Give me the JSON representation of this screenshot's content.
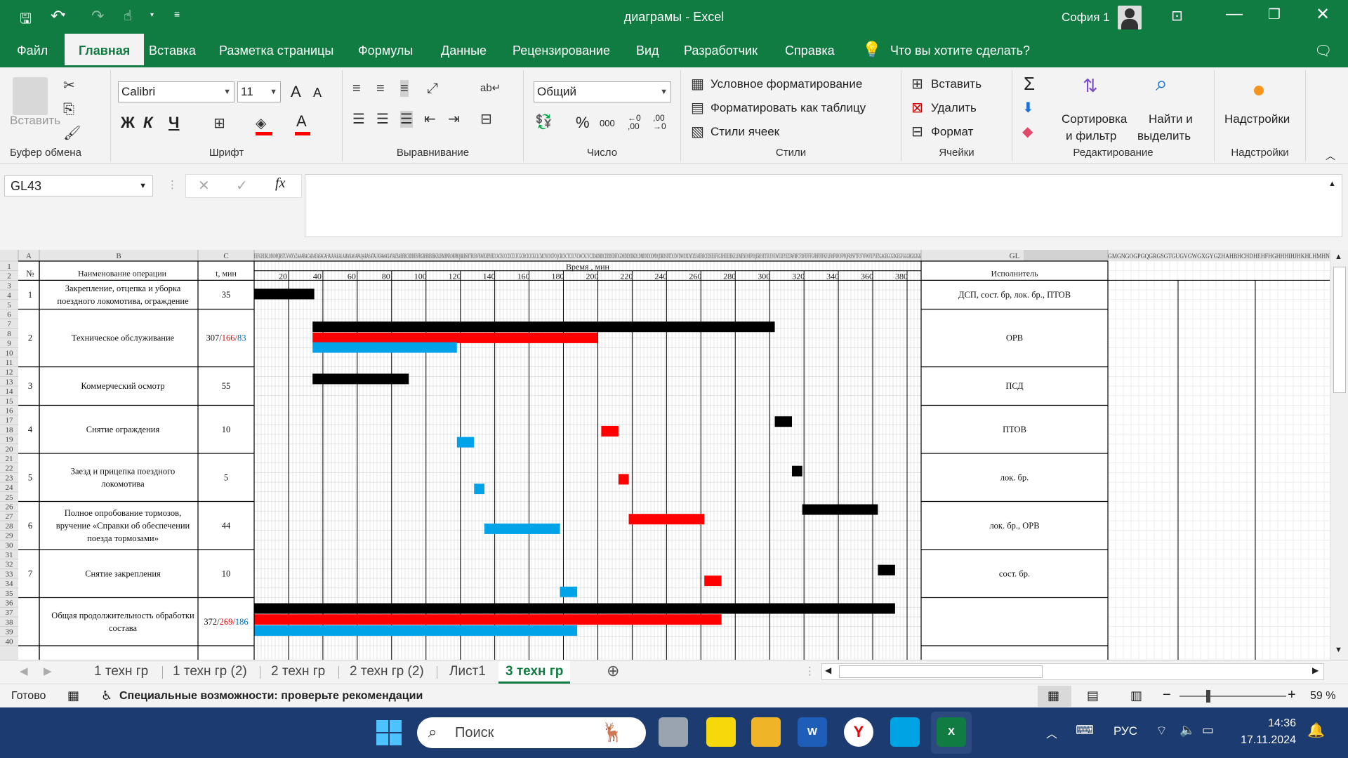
{
  "title": {
    "doc": "диаграмы  -  Excel",
    "user": "София 1"
  },
  "menu": [
    "Файл",
    "Главная",
    "Вставка",
    "Разметка страницы",
    "Формулы",
    "Данные",
    "Рецензирование",
    "Вид",
    "Разработчик",
    "Справка",
    "Что вы хотите сделать?"
  ],
  "ribbon": {
    "clipboard": {
      "label": "Буфер обмена",
      "paste": "Вставить"
    },
    "font": {
      "label": "Шрифт",
      "name": "Calibri",
      "size": "11",
      "bold": "Ж",
      "italic": "К",
      "underline": "Ч",
      "grow": "A",
      "shrink": "A"
    },
    "alignment": {
      "label": "Выравнивание"
    },
    "number": {
      "label": "Число",
      "format": "Общий",
      "percent": "%",
      "thousands": "000",
      "inc": "←0 ,00",
      "dec": ",00 →0"
    },
    "styles": {
      "label": "Стили",
      "cond": "Условное форматирование",
      "table": "Форматировать как таблицу",
      "cell": "Стили ячеек"
    },
    "cells": {
      "label": "Ячейки",
      "insert": "Вставить",
      "delete": "Удалить",
      "format": "Формат"
    },
    "editing": {
      "label": "Редактирование",
      "sort1": "Сортировка",
      "sort2": "и фильтр",
      "find1": "Найти и",
      "find2": "выделить",
      "sigma": "Σ"
    },
    "addins": {
      "label": "Надстройки",
      "btn": "Надстройки"
    }
  },
  "formula": {
    "namebox": "GL43",
    "fx": "fx",
    "value": ""
  },
  "grid": {
    "cols": {
      "a": "A",
      "b": "B",
      "c": "C",
      "gl": "GL",
      "timeCols": "EEFGHIJKLMNOPQRSTUVWXYZAAABACADAEAFAGAHAIAJAKALAMANAOAPAQARASATAUAVAWAXAYAZBABBBCBDBEBFBGBHBIBJBKBLBMBNBOBPBQBRBSBTBUBVBWBXBYBZCACBCCCDCECFCGCHCICJCKCLCMCNCOCPCQCRCSCTCUCVCWCXCYCZDADBDCDDDEDFDGDHDIDJDKDLDMDNDODPDQDRDSDTDUDVDWDXDYDZEAEBECEDEEEFEGEHEIEJEKELEMENEOEPEQERESETEUEVEWEXEYEZFAFBFCFDFEFFFGFHFIFJFKFLFMFNFOFPFQFRFSFTFUFVFWFXFYFZGAGBGCGDGEGFGGGHGIGJGK",
      "tailCols": "GMGNGOGPGQGRGSGTGUGVGWGXGYGZHAHBHCHDHEHFHGHHHIHJHKHLHMHN"
    },
    "header": {
      "num": "№",
      "name": "Наименование операции",
      "t": "t, мин",
      "time": "Время , мин",
      "exec": "Исполнитель"
    },
    "axisTicks": [
      "20",
      "40",
      "60",
      "80",
      "100",
      "120",
      "140",
      "160",
      "180",
      "200",
      "220",
      "240",
      "260",
      "280",
      "300",
      "320",
      "340",
      "360",
      "380"
    ],
    "rows": [
      {
        "n": "1",
        "name1": "Закрепление, отцепка и уборка",
        "name2": "поездного локомотива, ограждение",
        "name3": "",
        "t1": "35",
        "t2": "",
        "t3": "",
        "exec": "ДСП, сост. бр, лок. бр., ПТОВ"
      },
      {
        "n": "2",
        "name1": "Техническое обслуживание",
        "name2": "",
        "name3": "",
        "t1": "307/",
        "t2": "166/",
        "t3": "83",
        "exec": "ОРВ"
      },
      {
        "n": "3",
        "name1": "Коммерческий осмотр",
        "name2": "",
        "name3": "",
        "t1": "55",
        "t2": "",
        "t3": "",
        "exec": "ПСД"
      },
      {
        "n": "4",
        "name1": "Снятие ограждения",
        "name2": "",
        "name3": "",
        "t1": "10",
        "t2": "",
        "t3": "",
        "exec": "ПТОВ"
      },
      {
        "n": "5",
        "name1": "Заезд и прицепка поездного",
        "name2": "локомотива",
        "name3": "",
        "t1": "5",
        "t2": "",
        "t3": "",
        "exec": "лок. бр."
      },
      {
        "n": "6",
        "name1": "Полное опробование тормозов,",
        "name2": "вручение «Справки об обеспечении",
        "name3": "поезда тормозами»",
        "t1": "44",
        "t2": "",
        "t3": "",
        "exec": "лок. бр., ОРВ"
      },
      {
        "n": "7",
        "name1": "Снятие закрепления",
        "name2": "",
        "name3": "",
        "t1": "10",
        "t2": "",
        "t3": "",
        "exec": "сост. бр."
      },
      {
        "n": "",
        "name1": "Общая продолжительность обработки",
        "name2": "состава",
        "name3": "",
        "t1": "372/",
        "t2": "269/",
        "t3": "186",
        "exec": ""
      }
    ]
  },
  "gantt": {
    "xmin": 0,
    "xmax": 380,
    "colors": {
      "black": "#000000",
      "red": "#ff0000",
      "blue": "#00a2e8"
    },
    "bars": [
      {
        "op": 1,
        "color": "black",
        "start": 0,
        "end": 35
      },
      {
        "op": 2,
        "color": "black",
        "start": 34,
        "end": 303
      },
      {
        "op": 2,
        "color": "red",
        "start": 34,
        "end": 200
      },
      {
        "op": 2,
        "color": "blue",
        "start": 34,
        "end": 118
      },
      {
        "op": 3,
        "color": "black",
        "start": 34,
        "end": 90
      },
      {
        "op": 4,
        "color": "black",
        "start": 303,
        "end": 313
      },
      {
        "op": 4,
        "color": "red",
        "start": 202,
        "end": 212
      },
      {
        "op": 4,
        "color": "blue",
        "start": 118,
        "end": 128
      },
      {
        "op": 5,
        "color": "black",
        "start": 313,
        "end": 319
      },
      {
        "op": 5,
        "color": "red",
        "start": 212,
        "end": 218
      },
      {
        "op": 5,
        "color": "blue",
        "start": 128,
        "end": 134
      },
      {
        "op": 6,
        "color": "black",
        "start": 319,
        "end": 363
      },
      {
        "op": 6,
        "color": "red",
        "start": 218,
        "end": 262
      },
      {
        "op": 6,
        "color": "blue",
        "start": 134,
        "end": 178
      },
      {
        "op": 7,
        "color": "black",
        "start": 363,
        "end": 373
      },
      {
        "op": 7,
        "color": "red",
        "start": 262,
        "end": 272
      },
      {
        "op": 7,
        "color": "blue",
        "start": 178,
        "end": 188
      },
      {
        "op": 8,
        "color": "black",
        "start": 0,
        "end": 373
      },
      {
        "op": 8,
        "color": "red",
        "start": 0,
        "end": 272
      },
      {
        "op": 8,
        "color": "blue",
        "start": 0,
        "end": 188
      }
    ]
  },
  "tabs": [
    "1 техн гр",
    "1 техн гр (2)",
    "2 техн гр",
    "2 техн гр (2)",
    "Лист1",
    "3 техн гр"
  ],
  "status": {
    "ready": "Готово",
    "access": "Специальные возможности: проверьте рекомендации",
    "zoom": "59 %"
  },
  "taskbar": {
    "search": "Поиск",
    "lang": "РУС",
    "time": "14:36",
    "date": "17.11.2024"
  }
}
